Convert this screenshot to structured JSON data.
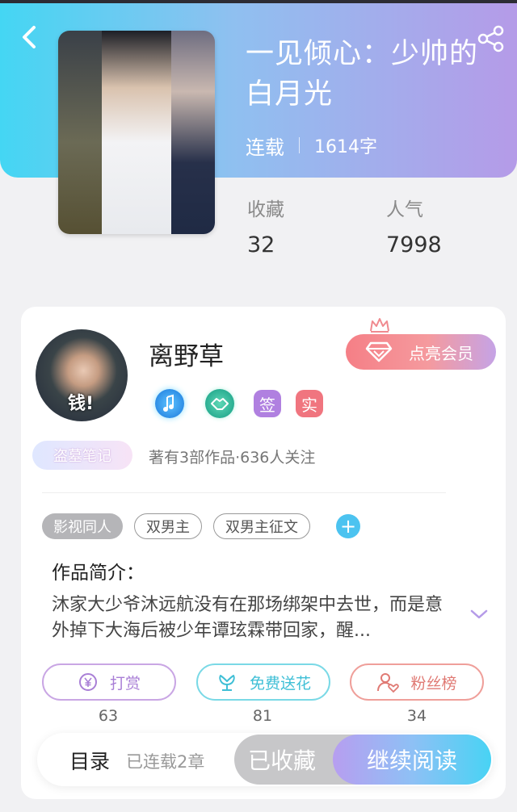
{
  "header": {
    "title": "一见倾心：少帅的白月光",
    "status": "连载",
    "word_count": "1614字"
  },
  "stats": {
    "favorites_label": "收藏",
    "favorites_value": "32",
    "popularity_label": "人气",
    "popularity_value": "7998"
  },
  "author": {
    "name": "离野草",
    "avatar_text": "钱!",
    "vip_button": "点亮会员",
    "badges": [
      "签",
      "实"
    ],
    "pen_badge": "盗墓笔记",
    "meta": "著有3部作品·636人关注"
  },
  "tags": [
    "影视同人",
    "双男主",
    "双男主征文"
  ],
  "intro": {
    "heading": "作品简介：",
    "text": "沐家大少爷沐远航没有在那场绑架中去世，而是意外掉下大海后被少年谭玹霖带回家，醒..."
  },
  "actions": [
    {
      "label": "打赏",
      "count": "63"
    },
    {
      "label": "免费送花",
      "count": "81"
    },
    {
      "label": "粉丝榜",
      "count": "34"
    }
  ],
  "bottom": {
    "toc": "目录",
    "chapters": "已连载2章",
    "favorited": "已收藏",
    "continue": "继续阅读"
  },
  "colors": {
    "header_gradient_start": "#44d6f3",
    "header_gradient_end": "#b59be8",
    "accent_cyan": "#4cc3f0",
    "tip_purple": "#a97fd6",
    "fans_red": "#e07a74"
  }
}
